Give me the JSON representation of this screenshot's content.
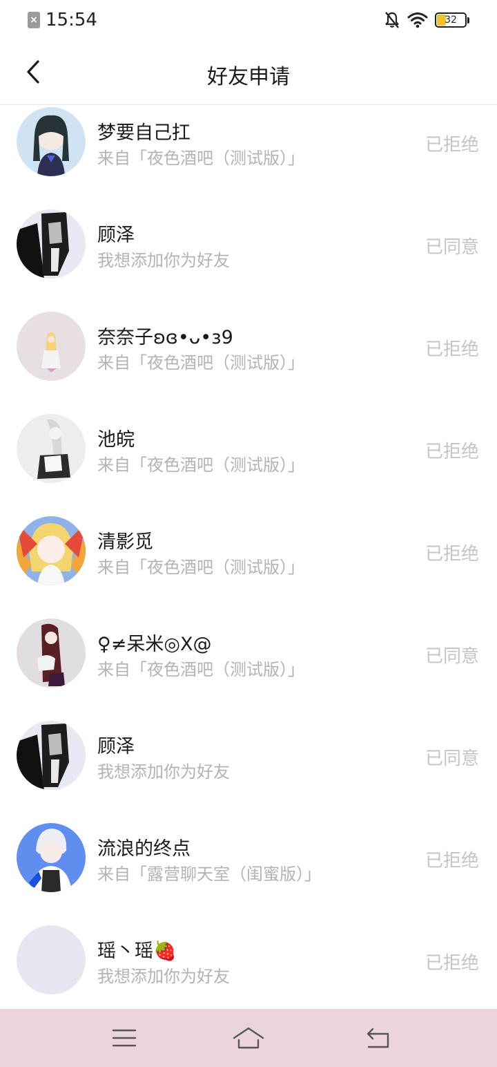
{
  "status_bar": {
    "time": "15:54",
    "battery_level": "32",
    "battery_fraction": 0.32,
    "icons": [
      "sim-disabled-icon",
      "mute-bell-icon",
      "wifi-icon",
      "battery-icon"
    ]
  },
  "header": {
    "title": "好友申请",
    "back_icon": "chevron-left-icon"
  },
  "requests": [
    {
      "name": "梦要自己扛",
      "message": "来自「夜色酒吧（测试版）」",
      "status": "已拒绝",
      "avatar_color": "#cfe3f3"
    },
    {
      "name": "顾泽",
      "message": "我想添加你为好友",
      "status": "已同意",
      "avatar_color": "#2b2b2b"
    },
    {
      "name": "奈奈子ʚɞ•ᴗ•ɜ9",
      "message": "来自「夜色酒吧（测试版）」",
      "status": "已拒绝",
      "avatar_color": "#e8dfe3"
    },
    {
      "name": "池皖",
      "message": "来自「夜色酒吧（测试版）」",
      "status": "已拒绝",
      "avatar_color": "#ededf0"
    },
    {
      "name": "清影觅",
      "message": "来自「夜色酒吧（测试版）」",
      "status": "已拒绝",
      "avatar_color": "#f2c95a"
    },
    {
      "name": "♀≠呆米◎X@",
      "message": "来自「夜色酒吧（测试版）」",
      "status": "已同意",
      "avatar_color": "#e2dde0"
    },
    {
      "name": "顾泽",
      "message": "我想添加你为好友",
      "status": "已同意",
      "avatar_color": "#2b2b2b"
    },
    {
      "name": "流浪的终点",
      "message": "来自「露营聊天室（闺蜜版）」",
      "status": "已拒绝",
      "avatar_color": "#5f8ef0"
    },
    {
      "name": "瑶丶瑶🍓",
      "message": "我想添加你为好友",
      "status": "已拒绝",
      "avatar_color": "#e6e6f0"
    }
  ],
  "bottom_nav": {
    "icons": [
      "menu-icon",
      "home-icon",
      "back-icon"
    ],
    "background": "#ecd5d8"
  },
  "colors": {
    "status_text": "#c4c4c4",
    "subtext": "#b3b3b3",
    "battery_accent": "#f2c12e"
  }
}
